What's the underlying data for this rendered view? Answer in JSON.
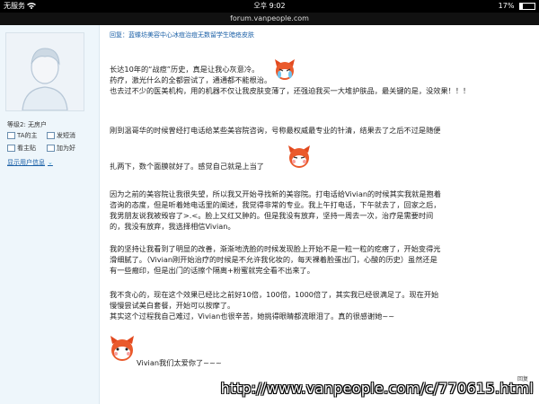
{
  "status_bar": {
    "carrier": "无服务",
    "time": "오후 9:02",
    "battery": "17%",
    "battery_level": 0.17
  },
  "url_bar": {
    "domain": "forum.vanpeople.com"
  },
  "sidebar": {
    "level_text": "等级2: 无房户",
    "ta_posts": "TA的主",
    "send_pm": "发短消",
    "view_thread": "看主贴",
    "add_friend": "加为好",
    "show_user_info": "显示用户信息"
  },
  "post": {
    "reply_title": "回复：蓝蝶坊美容中心冰痘治痘无数留学生暗疮皮肤",
    "lines": [
      "长达10年的“战痘”历史，真是让我心灰意冷。",
      "药疗，激光什么的全都尝试了，通通都不能根治。",
      "也去过不少的医美机构，用的机器不仅让我皮肤变薄了，还强迫我买一大堆护肤品，最关键的是，没效果！！！",
      "刚到温哥华的时候曾经打电话给某些美容院咨询，号称最权威最专业的针清，结果去了之后不过是随便",
      "扎两下，数个面膜就好了。感觉自己就是上当了",
      "因为之前的美容院让我很失望，所以我又开始寻找新的美容院。打电话给Vivian的时候其实我就是抱着",
      "咨询的态度，但是听着她电话里的阐述，我觉得非常的专业。我上午打电话，下午就去了，回家之后，",
      "我男朋友说我被毁容了>.<。脸上又红又肿的。但是我没有放弃，坚持一周去一次，治疗是需要时间",
      "的，我没有放弃，我选择相信Vivian。",
      "我的坚持让我看到了明显的改善，渐渐地洗脸的时候发现脸上开始不是一粒一粒的疙瘩了，开始变得光",
      "滑细腻了。（Vivian刚开始治疗的时候是不允许我化妆的，每天裸着脸蛋出门，心酸的历史）虽然还是",
      "有一些瘢印，但是出门的话擦个隔离+粉蜜就完全看不出来了。",
      "我不贪心的，现在这个效果已经比之前好10倍，100倍，1000倍了，其实我已经很满足了。现在开始",
      "慢慢尝试美白套餐，开始可以按摩了。",
      "其实这个过程我自己难过，Vivian也很辛苦，她挑得眼睛都流眼泪了。真的很感谢她~~",
      "Vivian我们太爱你了~~~"
    ]
  },
  "reply_tag": "回复",
  "watermark": "http://www.vanpeople.com/c/770615.html"
}
